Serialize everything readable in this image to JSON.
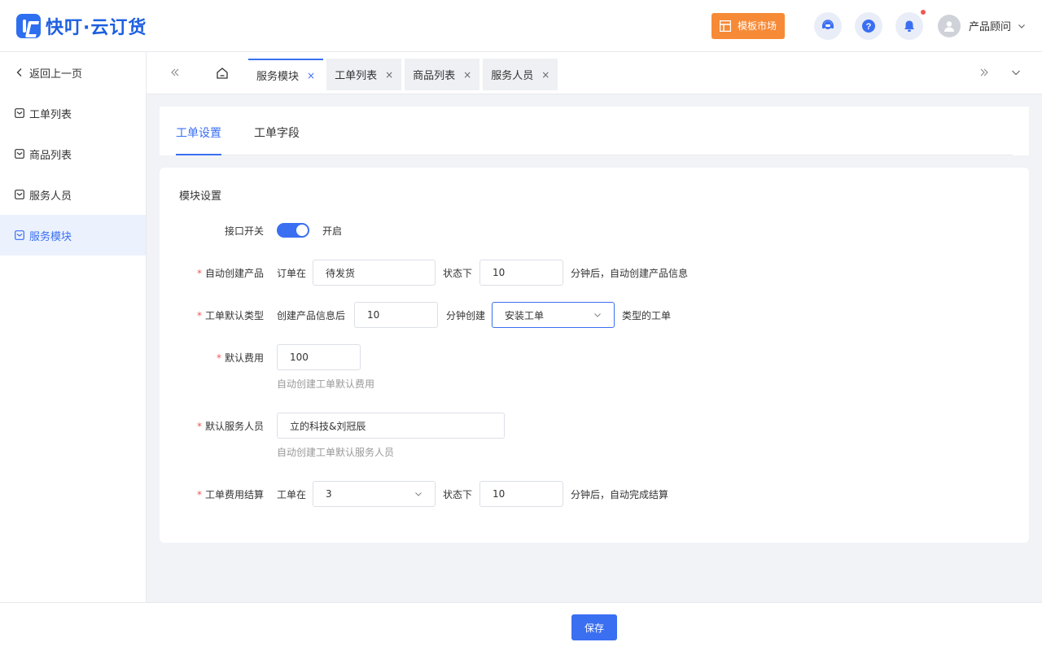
{
  "app": {
    "logo_text": "快叮·云订货"
  },
  "header": {
    "market_label": "模板市场",
    "user_name": "产品顾问",
    "icons": [
      "service-icon",
      "help-icon",
      "bell-icon",
      "user-avatar-icon"
    ]
  },
  "sidebar": {
    "back_label": "返回上一页",
    "items": [
      {
        "label": "工单列表"
      },
      {
        "label": "商品列表"
      },
      {
        "label": "服务人员"
      },
      {
        "label": "服务模块"
      }
    ]
  },
  "tabs": [
    {
      "label": "服务模块",
      "close": "×"
    },
    {
      "label": "工单列表",
      "close": "×"
    },
    {
      "label": "商品列表",
      "close": "×"
    },
    {
      "label": "服务人员",
      "close": "×"
    }
  ],
  "sub_tabs": [
    "工单设置",
    "工单字段"
  ],
  "form": {
    "section_title": "模块设置",
    "api_switch": {
      "label": "接口开关",
      "state_text": "开启"
    },
    "auto_create": {
      "required": "*",
      "label": "自动创建产品",
      "prefix": "订单在",
      "status_value": "待发货",
      "mid": "状态下",
      "minutes_value": "10",
      "suffix": "分钟后，自动创建产品信息"
    },
    "default_type": {
      "required": "*",
      "label": "工单默认类型",
      "prefix": "创建产品信息后",
      "minutes_value": "10",
      "mid": "分钟创建",
      "type_value": "安装工单",
      "suffix": "类型的工单"
    },
    "default_fee": {
      "required": "*",
      "label": "默认费用",
      "value": "100",
      "hint": "自动创建工单默认费用"
    },
    "default_staff": {
      "required": "*",
      "label": "默认服务人员",
      "value": "立的科技&刘冠辰",
      "hint": "自动创建工单默认服务人员"
    },
    "settlement": {
      "required": "*",
      "label": "工单费用结算",
      "prefix": "工单在",
      "status_value": "3",
      "mid": "状态下",
      "minutes_value": "10",
      "suffix": "分钟后，自动完成结算"
    }
  },
  "footer": {
    "save_label": "保存"
  },
  "colors": {
    "primary": "#3a6ff2",
    "market": "#f68a37",
    "required": "#f25656"
  }
}
